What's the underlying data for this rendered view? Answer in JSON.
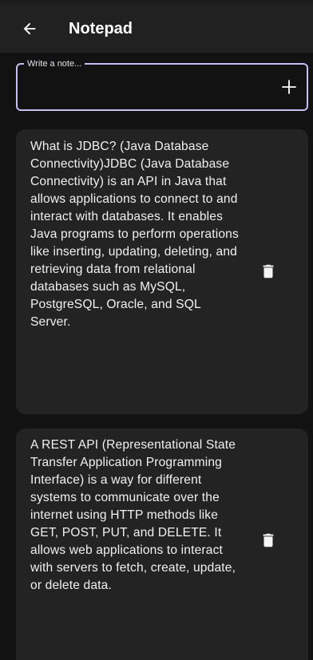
{
  "app_bar": {
    "title": "Notepad",
    "back_icon": "arrow-left-icon"
  },
  "note_input": {
    "label": "Write a note...",
    "value": "",
    "add_icon": "plus-icon"
  },
  "notes": [
    {
      "text": "What is JDBC? (Java Database Connectivity)JDBC (Java Database Connectivity) is an API in Java that allows applications to connect to and interact with databases. It enables Java programs to perform operations like inserting, updating, deleting, and retrieving data from relational databases such as MySQL, PostgreSQL, Oracle, and SQL Server.",
      "delete_icon": "trash-icon"
    },
    {
      "text": "A REST API (Representational State Transfer Application Programming Interface) is a way for different systems to communicate over the internet using HTTP methods like GET, POST, PUT, and DELETE. It allows web applications to interact with servers to fetch, create, update, or delete data.",
      "delete_icon": "trash-icon"
    }
  ],
  "colors": {
    "background": "#121212",
    "app_bar": "#212121",
    "card": "#232323",
    "accent_outline": "#c9bdf3",
    "text": "#ffffff"
  }
}
